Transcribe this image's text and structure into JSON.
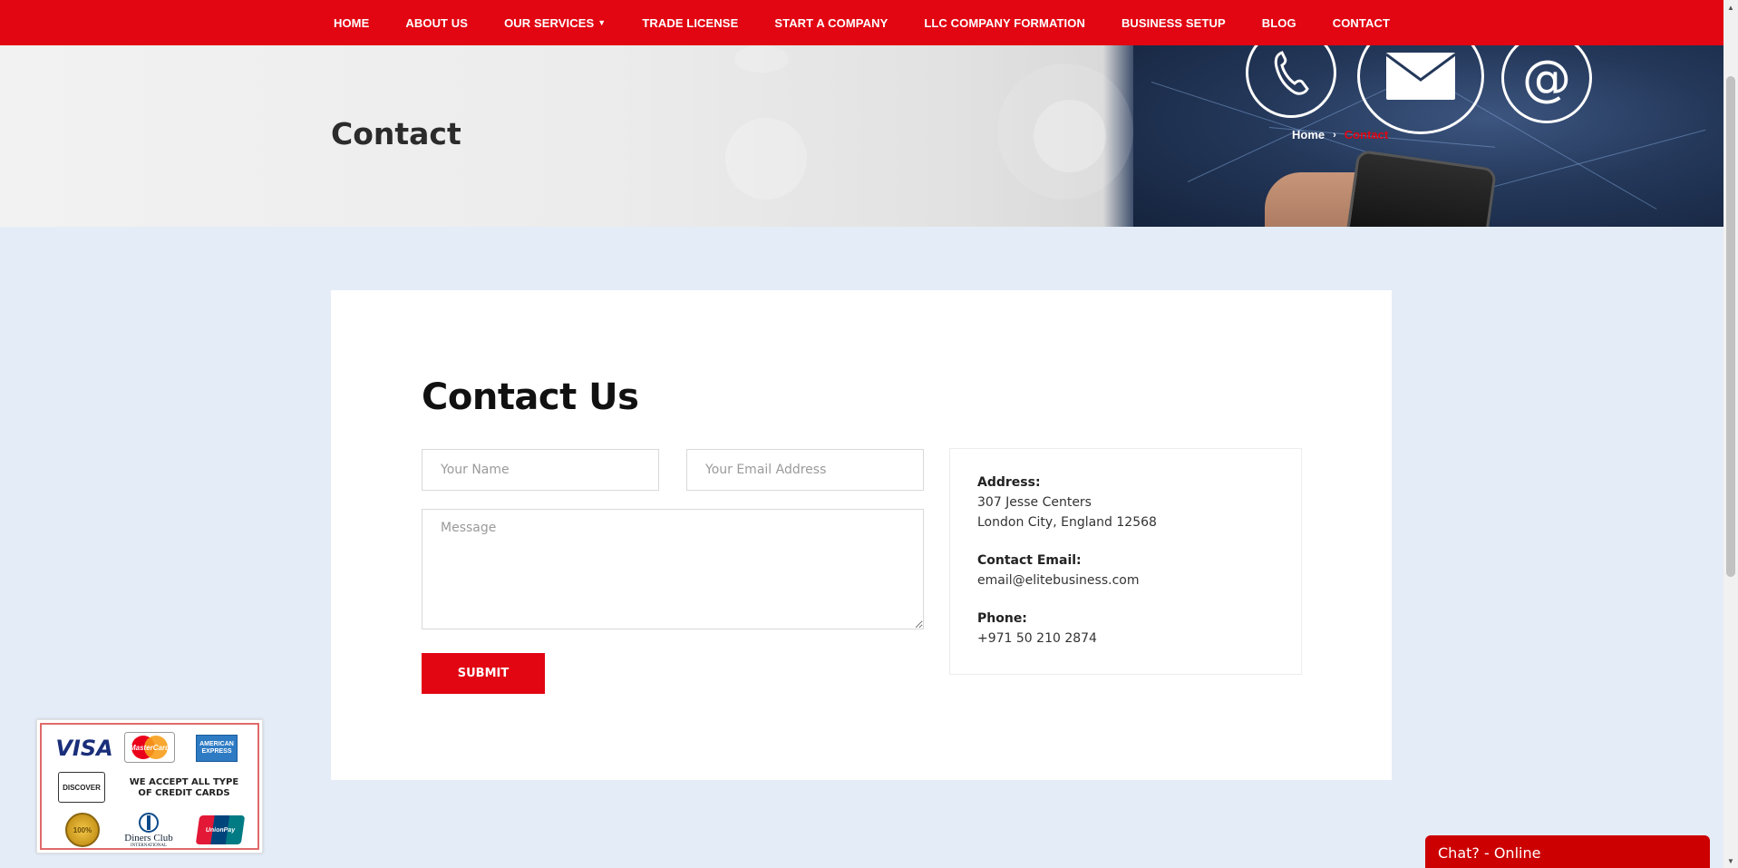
{
  "nav": {
    "items": [
      {
        "label": "HOME"
      },
      {
        "label": "ABOUT US"
      },
      {
        "label": "OUR SERVICES",
        "has_dropdown": true
      },
      {
        "label": "TRADE LICENSE"
      },
      {
        "label": "START A COMPANY"
      },
      {
        "label": "LLC COMPANY FORMATION"
      },
      {
        "label": "BUSINESS SETUP"
      },
      {
        "label": "BLOG"
      },
      {
        "label": "CONTACT"
      }
    ]
  },
  "hero": {
    "title": "Contact",
    "breadcrumb": {
      "home": "Home",
      "separator": "›",
      "current": "Contact"
    },
    "icons": [
      "phone-icon",
      "envelope-icon",
      "at-sign-icon"
    ]
  },
  "contact": {
    "title": "Contact Us",
    "form": {
      "name_placeholder": "Your Name",
      "email_placeholder": "Your Email Address",
      "message_placeholder": "Message",
      "submit_label": "SUBMIT"
    },
    "info": {
      "address_label": "Address:",
      "address_line1": "307 Jesse Centers",
      "address_line2": "London City, England 12568",
      "email_label": "Contact Email:",
      "email_value": "email@elitebusiness.com",
      "phone_label": "Phone:",
      "phone_value": "+971 50 210 2874"
    }
  },
  "payment_badge": {
    "visa": "VISA",
    "mastercard": "MasterCard",
    "amex_line1": "AMERICAN",
    "amex_line2": "EXPRESS",
    "discover": "DISCOVER",
    "accept_line1": "WE ACCEPT ALL TYPE",
    "accept_line2": "OF CREDIT CARDS",
    "seal": "100%",
    "diners_line1": "Diners Club",
    "diners_line2": "INTERNATIONAL",
    "unionpay": "UnionPay"
  },
  "chat": {
    "label": "Chat? - Online"
  },
  "colors": {
    "brand_red": "#e20512",
    "page_bg": "#e4ecf7",
    "chat_red": "#cc0000"
  }
}
